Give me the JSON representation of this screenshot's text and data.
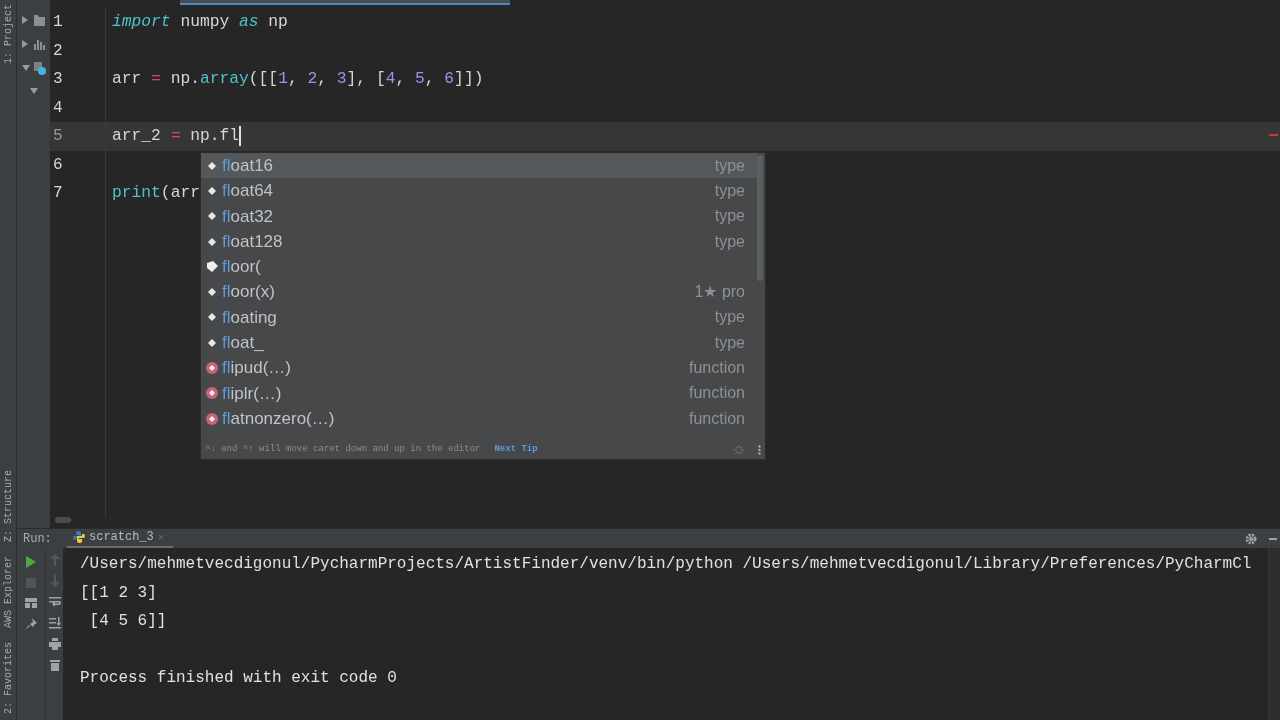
{
  "tool_strip": {
    "top": [
      "1: Project"
    ],
    "bottom": [
      "Z: Structure",
      "AWS Explorer",
      "2: Favorites"
    ]
  },
  "editor": {
    "lines": [
      {
        "number": "1",
        "current": false,
        "caret": false,
        "tokens": [
          {
            "kind": "keyword",
            "text": "import"
          },
          {
            "kind": "plain",
            "text": " numpy "
          },
          {
            "kind": "keyword",
            "text": "as"
          },
          {
            "kind": "plain",
            "text": " np"
          }
        ]
      },
      {
        "number": "2",
        "current": false,
        "caret": false
      },
      {
        "number": "3",
        "current": false,
        "caret": false,
        "tokens": [
          {
            "kind": "plain",
            "text": "arr "
          },
          {
            "kind": "operator",
            "text": "="
          },
          {
            "kind": "plain",
            "text": " np."
          },
          {
            "kind": "call",
            "text": "array"
          },
          {
            "kind": "plain",
            "text": "([["
          },
          {
            "kind": "number",
            "text": "1"
          },
          {
            "kind": "plain",
            "text": ", "
          },
          {
            "kind": "number",
            "text": "2"
          },
          {
            "kind": "plain",
            "text": ", "
          },
          {
            "kind": "number",
            "text": "3"
          },
          {
            "kind": "plain",
            "text": "], ["
          },
          {
            "kind": "number",
            "text": "4"
          },
          {
            "kind": "plain",
            "text": ", "
          },
          {
            "kind": "number",
            "text": "5"
          },
          {
            "kind": "plain",
            "text": ", "
          },
          {
            "kind": "number",
            "text": "6"
          },
          {
            "kind": "plain",
            "text": "]])"
          }
        ]
      },
      {
        "number": "4",
        "current": false,
        "caret": false
      },
      {
        "number": "5",
        "current": true,
        "caret": true,
        "tokens": [
          {
            "kind": "plain",
            "text": "arr_2 "
          },
          {
            "kind": "operator",
            "text": "="
          },
          {
            "kind": "plain",
            "text": " np.fl"
          }
        ]
      },
      {
        "number": "6",
        "current": false,
        "caret": false
      },
      {
        "number": "7",
        "current": false,
        "caret": false,
        "tokens": [
          {
            "kind": "call",
            "text": "print"
          },
          {
            "kind": "plain",
            "text": "(arr"
          }
        ]
      }
    ]
  },
  "completion_popup": {
    "items": [
      {
        "match": "fl",
        "rest": "oat16",
        "kind": "field",
        "type": "type",
        "selected": true
      },
      {
        "match": "fl",
        "rest": "oat64",
        "kind": "field",
        "type": "type",
        "selected": false
      },
      {
        "match": "fl",
        "rest": "oat32",
        "kind": "field",
        "type": "type",
        "selected": false
      },
      {
        "match": "fl",
        "rest": "oat128",
        "kind": "field",
        "type": "type",
        "selected": false
      },
      {
        "match": "fl",
        "rest": "oor(",
        "kind": "template",
        "selected": false
      },
      {
        "match": "fl",
        "rest": "oor(x)",
        "kind": "field",
        "type": "1★ pro",
        "selected": false
      },
      {
        "match": "fl",
        "rest": "oating",
        "kind": "field",
        "type": "type",
        "selected": false
      },
      {
        "match": "fl",
        "rest": "oat_",
        "kind": "field",
        "type": "type",
        "selected": false
      },
      {
        "match": "fl",
        "rest": "ipud(…)",
        "kind": "method",
        "type": "function",
        "selected": false
      },
      {
        "match": "fl",
        "rest": "iplr(…)",
        "kind": "method",
        "type": "function",
        "selected": false
      },
      {
        "match": "fl",
        "rest": "atnonzero(…)",
        "kind": "method",
        "type": "function",
        "selected": false
      }
    ],
    "hint": "^↓ and ^↑ will move caret down and up in the editor",
    "hint_link": "Next Tip"
  },
  "run_panel": {
    "label": "Run:",
    "tab": {
      "title": "scratch_3",
      "close": "×"
    },
    "output": [
      {
        "text": "/Users/mehmetvecdigonul/PycharmProjects/ArtistFinder/venv/bin/python /Users/mehmetvecdigonul/Library/Preferences/PyCharmCl",
        "spaced": false
      },
      {
        "text": "[[1 2 3]",
        "spaced": false
      },
      {
        "text": " [4 5 6]]",
        "spaced": false
      },
      {
        "text": "Process finished with exit code 0",
        "spaced": true
      }
    ]
  }
}
